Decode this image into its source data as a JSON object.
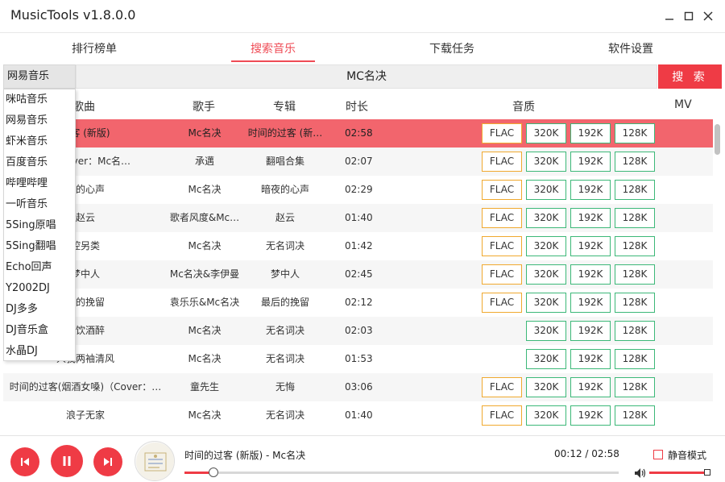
{
  "window": {
    "title": "MusicTools v1.8.0.0"
  },
  "tabs": [
    {
      "label": "排行榜单"
    },
    {
      "label": "搜索音乐"
    },
    {
      "label": "下载任务"
    },
    {
      "label": "软件设置"
    }
  ],
  "search": {
    "source": "网易音乐",
    "query": "MC名决",
    "button_label": "搜 索"
  },
  "source_options": [
    "咪咕音乐",
    "网易音乐",
    "虾米音乐",
    "百度音乐",
    "哔哩哔哩",
    "一听音乐",
    "5Sing原唱",
    "5Sing翻唱",
    "Echo回声",
    "Y2002DJ",
    "DJ多多",
    "DJ音乐盒",
    "水晶DJ"
  ],
  "table": {
    "headers": {
      "song": "歌曲",
      "artist": "歌手",
      "album": "专辑",
      "duration": "时长",
      "quality": "音质",
      "mv": "MV"
    },
    "rows": [
      {
        "song": "过客 (新版)",
        "artist": "Mc名决",
        "album": "时间的过客 (新…",
        "duration": "02:58",
        "flac": true
      },
      {
        "song": "生（Cover：Mc名…",
        "artist": "承邁",
        "album": "翻唱合集",
        "duration": "02:07",
        "flac": true
      },
      {
        "song": "夜的心声",
        "artist": "Mc名决",
        "album": "暗夜的心声",
        "duration": "02:29",
        "flac": true
      },
      {
        "song": "赵云",
        "artist": "歌者风度&Mc…",
        "album": "赵云",
        "duration": "01:40",
        "flac": true
      },
      {
        "song": "控另类",
        "artist": "Mc名决",
        "album": "无名词决",
        "duration": "01:42",
        "flac": true
      },
      {
        "song": "梦中人",
        "artist": "Mc名决&李伊曼",
        "album": "梦中人",
        "duration": "02:45",
        "flac": true
      },
      {
        "song": "后的挽留",
        "artist": "袁乐乐&Mc名决",
        "album": "最后的挽留",
        "duration": "02:12",
        "flac": true
      },
      {
        "song": "我饮酒醉",
        "artist": "Mc名决",
        "album": "无名词决",
        "duration": "02:03",
        "flac": false
      },
      {
        "song": "人我两袖清风",
        "artist": "Mc名决",
        "album": "无名词决",
        "duration": "01:53",
        "flac": false
      },
      {
        "song": "时间的过客(烟酒女嗓)（Cover：…",
        "artist": "童先生",
        "album": "无悔",
        "duration": "03:06",
        "flac": true
      },
      {
        "song": "浪子无家",
        "artist": "Mc名决",
        "album": "无名词决",
        "duration": "01:40",
        "flac": true
      }
    ],
    "quality_labels": {
      "flac": "FLAC",
      "q320": "320K",
      "q192": "192K",
      "q128": "128K"
    }
  },
  "player": {
    "now_playing": "时间的过客 (新版) - Mc名决",
    "time": "00:12 / 02:58",
    "progress": 0.067,
    "mute_label": "静音模式",
    "volume": 1.0
  },
  "colors": {
    "accent": "#ef3b45",
    "playing_row": "#f2656d",
    "flac_border": "#f0a92f",
    "quality_border": "#3cb878"
  },
  "icons": {
    "prev": "skip-previous-icon",
    "pause": "pause-icon",
    "next": "skip-next-icon",
    "volume": "speaker-icon"
  }
}
